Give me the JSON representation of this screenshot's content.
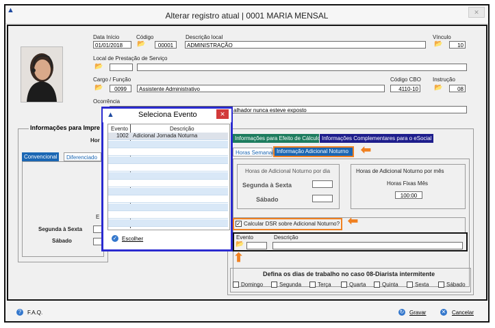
{
  "window": {
    "title": "Alterar registro atual | 0001 MARIA MENSAL",
    "close": "✕"
  },
  "employee": {
    "data_inicio_label": "Data Início",
    "data_inicio": "01/01/2018",
    "codigo_label": "Código",
    "codigo": "00001",
    "descricao_local_label": "Descrição local",
    "descricao_local": "ADMINISTRAÇÃO",
    "vinculo_label": "Vínculo",
    "vinculo": "10",
    "local_prestacao_label": "Local de Prestação de Serviço",
    "cargo_label": "Cargo / Função",
    "cargo_codigo": "0099",
    "cargo_descricao": "Assistente Administrativo",
    "cbo_label": "Código CBO",
    "cbo": "4110-10",
    "instrucao_label": "Instrução",
    "instrucao": "08",
    "ocorrencia_label": "Ocorrência",
    "ocorrencia_value": "alhador nunca esteve exposto"
  },
  "left_panel": {
    "group_title": "Informações para Impre",
    "hor_label": "Hor",
    "tab_convencional": "Convencional",
    "tab_diferenciado": "Diferenciado",
    "e_label": "E",
    "segunda_sexta": "Segunda à Sexta",
    "sabado": "Sábado"
  },
  "right_panel": {
    "tab_calculo": "Informações para Efeito de Cálculo",
    "tab_esocial": "Informações Complementares para o eSocial",
    "subtab_horas": "Horas Semanais",
    "subtab_adicional": "Informação Adicional Noturno",
    "por_dia_title": "Horas de Adicional Noturno por dia",
    "segunda_sexta": "Segunda à Sexta",
    "sabado": "Sábado",
    "por_mes_title": "Horas de Adicional Noturno por mês",
    "horas_fixas_label": "Horas Fixas Mês",
    "horas_fixas_value": "100:00",
    "calcular_dsr_label": "Calcular DSR sobre Adicional Noturno?",
    "calcular_dsr_checked": true,
    "evento_label": "Evento",
    "descricao_label": "Descrição",
    "defina_title": "Defina os dias de trabalho no caso 08-Diarista intermitente",
    "dias": [
      "Domingo",
      "Segunda",
      "Terça",
      "Quarta",
      "Quinta",
      "Sexta",
      "Sábado"
    ]
  },
  "modal": {
    "title": "Seleciona Evento",
    "col_evento": "Evento",
    "col_descricao": "Descrição",
    "rows": [
      {
        "evento": "1002",
        "descricao": "Adicional Jornada Noturna"
      }
    ],
    "escolher": "Escolher"
  },
  "footer": {
    "faq": "F.A.Q.",
    "gravar": "Gravar",
    "cancelar": "Cancelar"
  },
  "colors": {
    "accent_orange": "#f08020",
    "modal_border": "#2a2ad0",
    "tab_blue": "#1a66b3",
    "tab_green": "#1d7c5e"
  }
}
